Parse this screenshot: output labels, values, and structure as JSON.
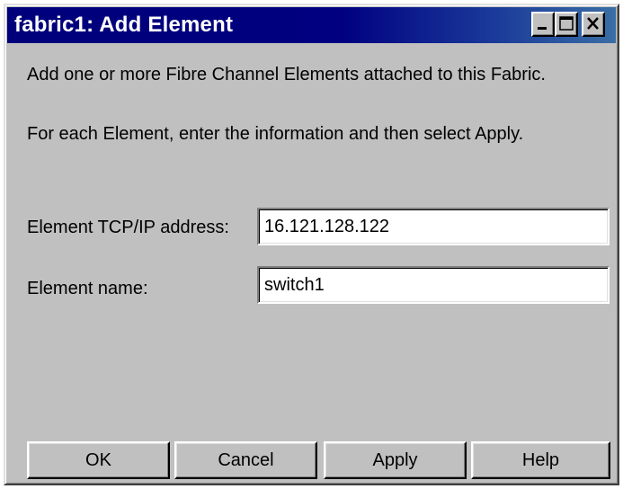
{
  "window": {
    "title": "fabric1: Add Element",
    "titlebar_color": "#000080"
  },
  "titlebar_controls": {
    "minimize_icon": "minimize-icon",
    "maximize_icon": "maximize-icon",
    "close_icon": "close-icon"
  },
  "instructions": {
    "line1": "Add one or more Fibre Channel Elements attached to this Fabric.",
    "line2": "For each Element, enter the information and then select Apply."
  },
  "form": {
    "address_label": "Element TCP/IP address:",
    "address_value": "16.121.128.122",
    "name_label": "Element name:",
    "name_value": "switch1"
  },
  "buttons": {
    "ok": "OK",
    "cancel": "Cancel",
    "apply": "Apply",
    "help": "Help"
  }
}
